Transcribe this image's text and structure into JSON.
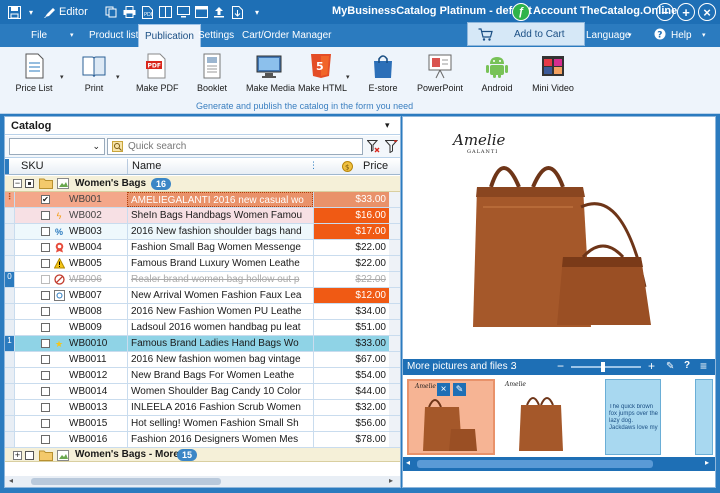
{
  "titlebar": {
    "editor_label": "Editor",
    "title": "MyBusinessCatalog Platinum - default",
    "account": "Account TheCatalog.Online",
    "account_logo_glyph": "ƒ",
    "minimize": "−",
    "maximize": "+",
    "close": "×"
  },
  "tabs": {
    "file": "File",
    "product_list": "Product list",
    "publication": "Publication",
    "settings": "Settings",
    "cart_order": "Cart/Order Manager",
    "add_to_cart": "Add to Cart",
    "language": "Language",
    "help": "Help"
  },
  "ribbon": {
    "buttons": [
      {
        "label": "Price List"
      },
      {
        "label": "Print"
      },
      {
        "label": "Make PDF"
      },
      {
        "label": "Booklet"
      },
      {
        "label": "Make Media"
      },
      {
        "label": "Make HTML"
      },
      {
        "label": "E-store"
      },
      {
        "label": "PowerPoint"
      },
      {
        "label": "Android"
      },
      {
        "label": "Mini Video"
      }
    ],
    "caption": "Generate and publish the catalog in the form you need"
  },
  "catalog": {
    "header": "Catalog",
    "search_placeholder": "Quick search",
    "col_sku": "SKU",
    "col_name": "Name",
    "col_price": "Price",
    "groups": [
      {
        "name": "Women's Bags",
        "count": "16"
      },
      {
        "name": "Women's Bags - More",
        "count": "15"
      }
    ],
    "rows": [
      {
        "sku": "WB001",
        "name": "AMELIEGALANTI 2016 new casual wo",
        "price": "$33.00"
      },
      {
        "sku": "WB002",
        "name": "SheIn Bags Handbags Women Famou",
        "price": "$16.00"
      },
      {
        "sku": "WB003",
        "name": "2016 New fashion shoulder bags hand",
        "price": "$17.00"
      },
      {
        "sku": "WB004",
        "name": "Fashion Small Bag Women Messenge",
        "price": "$22.00"
      },
      {
        "sku": "WB005",
        "name": "Famous Brand Luxury Women Leathe",
        "price": "$22.00"
      },
      {
        "sku": "WB006",
        "name": "Realer brand women bag hollow out p",
        "price": "$22.00"
      },
      {
        "sku": "WB007",
        "name": "New Arrival Women Fashion Faux Lea",
        "price": "$12.00"
      },
      {
        "sku": "WB008",
        "name": "2016 New Fashion Women PU Leathe",
        "price": "$34.00"
      },
      {
        "sku": "WB009",
        "name": "Ladsoul 2016 women handbag pu leat",
        "price": "$51.00"
      },
      {
        "sku": "WB0010",
        "name": "Famous Brand Ladies Hand Bags Wo",
        "price": "$33.00"
      },
      {
        "sku": "WB0011",
        "name": "2016 New fashion women bag vintage",
        "price": "$67.00"
      },
      {
        "sku": "WB0012",
        "name": "New Brand Bags For Women Leathe",
        "price": "$54.00"
      },
      {
        "sku": "WB0014",
        "name": "Women Shoulder Bag Candy 10 Color",
        "price": "$44.00"
      },
      {
        "sku": "WB0013",
        "name": "INLEELA 2016 Fashion Scrub Women",
        "price": "$32.00"
      },
      {
        "sku": "WB0015",
        "name": "Hot selling! Women Fashion Small Sh",
        "price": "$56.00"
      },
      {
        "sku": "WB0016",
        "name": "Fashion 2016 Designers Women Mes",
        "price": "$78.00"
      }
    ],
    "row_indicators": {
      "row6": "0",
      "row10": "1"
    }
  },
  "preview": {
    "brand_logo": "Amelie",
    "brand_sub": "GALANTI"
  },
  "more_pictures": {
    "label": "More pictures and files :",
    "count": "3",
    "thumb_text": "The quick brown fox jumps over the lazy dog. Jackdaws love my big sphinx of quartz. The five boxing wi"
  },
  "colors": {
    "accent": "#1e6fb5",
    "selected_row": "#f4a78a",
    "highlight_row": "#8fd3e6",
    "price_highlight": "#f05a14"
  }
}
